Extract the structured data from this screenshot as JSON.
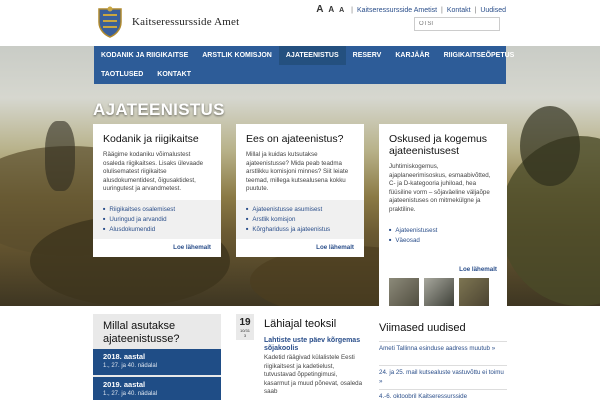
{
  "header": {
    "site_name": "Kaitseressursside Amet",
    "font_sizes": [
      "A",
      "A",
      "A"
    ],
    "links": [
      "Kaitseressursside Ametist",
      "Kontakt",
      "Uudised"
    ],
    "search_placeholder": "OTSI"
  },
  "nav": {
    "row1": [
      "Kodanik ja riigikaitse",
      "Arstlik komisjon",
      "Ajateenistus",
      "Reserv",
      "Karjäär",
      "Riigikaitseõpetus"
    ],
    "row2": [
      "Taotlused",
      "Kontakt"
    ],
    "active": "Ajateenistus"
  },
  "page_title": "Ajateenistus",
  "cards": [
    {
      "title": "Kodanik ja riigikaitse",
      "text": "Räägime kodaniku võimalustest osaleda riigikaitses. Lisaks ülevaade olulisematest riigikaitse alusdokumentidest, õigusaktidest, uuringutest ja arvandmetest.",
      "links": [
        "Riigikaitses osalemisest",
        "Uuringud ja arvandid",
        "Alusdokumendid"
      ],
      "more": "Loe lähemalt"
    },
    {
      "title": "Ees on ajateenistus?",
      "text": "Millal ja kuidas kutsutakse ajateenistusse? Mida peab teadma arstlikku komisjoni minnes? Siit leiate teemad, millega kutsealusena kokku puutute.",
      "links": [
        "Ajateenistusse asumisest",
        "Arstlik komisjon",
        "Kõrghariduss ja ajateenistus"
      ],
      "more": "Loe lähemalt"
    },
    {
      "title": "Oskused ja kogemus ajateenistusest",
      "text": "Juhtimiskogemus, ajaplaneerimisoskus, esmaabivõtted, C- ja D-kategooria juhiload, hea füüsiline vorm – sõjaväeline väljaõpe ajateenistuses on mitmekülgne ja praktiline.",
      "links": [
        "Ajateenistusest",
        "Väeosad"
      ],
      "more": "Loe lähemalt"
    }
  ],
  "when_box": {
    "title": "Millal asutakse ajateenistusse?",
    "years": [
      {
        "year": "2018. aastal",
        "weeks": "1., 27. ja 40. nädalal"
      },
      {
        "year": "2019. aastal",
        "weeks": "1., 27. ja 40. nädalal"
      }
    ]
  },
  "events": {
    "title": "Lähiajal teoksil",
    "badge_day": "19",
    "badge_month": "10/31",
    "badge_extra": "3",
    "event_title": "Lahtiste uste päev kõrgemas sõjakoolis",
    "event_text": "Kadetid räägivad külalistele Eesti riigikaitsest ja kadetielust, tutvustavad õppetingimusi, kasarmut ja muud põnevat, osaleda saab"
  },
  "news": {
    "title": "Viimased uudised",
    "items": [
      "Ameti Tallinna esinduse aadress muutub »",
      "24. ja 25. mail kutsealuste vastuvõttu ei toimu »",
      "4.-6. oktoobril Kaitseressursside"
    ]
  },
  "colors": {
    "nav_blue": "#2d5c98",
    "link_blue": "#2a4e8a",
    "year_block": "#1f4d86"
  }
}
